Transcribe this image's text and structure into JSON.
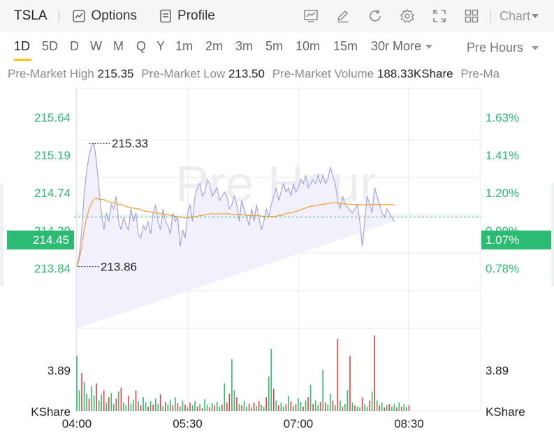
{
  "header": {
    "ticker": "TSLA",
    "options_label": "Options",
    "profile_label": "Profile",
    "chart_selector": "Chart"
  },
  "icons": [
    "options-chart-icon",
    "profile-document-icon",
    "indicator-icon",
    "draw-pen-icon",
    "refresh-icon",
    "settings-gear-icon",
    "fullscreen-icon",
    "layout-grid-icon"
  ],
  "periods": [
    "1D",
    "5D",
    "D",
    "W",
    "M",
    "Q",
    "Y",
    "1m",
    "2m",
    "3m",
    "5m",
    "10m",
    "15m",
    "30r",
    "More"
  ],
  "active_period": "1D",
  "session_selector": "Pre Hours",
  "stats": {
    "high_label": "Pre-Market High",
    "high_value": "215.35",
    "low_label": "Pre-Market Low",
    "low_value": "213.50",
    "volume_label": "Pre-Market Volume",
    "volume_value": "188.33KShare",
    "cut_label": "Pre-Ma"
  },
  "colors": {
    "up": "#2bbb72",
    "down": "#ef3b3b",
    "price_line": "#a7a2e3",
    "avg_line": "#f0a445",
    "grid": "#e6e8ec",
    "accent": "#f2c80f"
  },
  "chart_data": {
    "type": "line",
    "watermark": "Pre Hour",
    "x_ticks": [
      "04:00",
      "05:30",
      "07:00",
      "08:30"
    ],
    "x_range_minutes": [
      0,
      270
    ],
    "y_ticks": [
      "215.64",
      "215.19",
      "214.74",
      "214.29",
      "213.84"
    ],
    "y_range": [
      213.72,
      216.04
    ],
    "pct_ticks": [
      "1.63%",
      "1.41%",
      "1.20%",
      "0.99%",
      "0.78%"
    ],
    "current_price": "214.45",
    "current_pct": "1.07%",
    "annot_high": "215.33",
    "annot_low": "213.86",
    "volume_tick": "3.89",
    "volume_unit": "KShare",
    "price_series": {
      "x": [
        0,
        2,
        4,
        6,
        8,
        10,
        12,
        14,
        16,
        18,
        20,
        22,
        24,
        26,
        28,
        30,
        32,
        34,
        36,
        38,
        40,
        42,
        44,
        46,
        48,
        50,
        52,
        54,
        56,
        58,
        60,
        62,
        64,
        66,
        68,
        70,
        72,
        74,
        76,
        78,
        80,
        82,
        84,
        86,
        88,
        90,
        92,
        94,
        96,
        98,
        100,
        102,
        104,
        106,
        108,
        110,
        112,
        114,
        116,
        118,
        120,
        122,
        124,
        126,
        128,
        130,
        132,
        134,
        136,
        138,
        140,
        142,
        144,
        146,
        148,
        150,
        152,
        154,
        156,
        158,
        160,
        162,
        164,
        166,
        168,
        170,
        172,
        174,
        176,
        178,
        180,
        182,
        184,
        186,
        188,
        190,
        192,
        194,
        196,
        198,
        200,
        202,
        204,
        206,
        208,
        210,
        212,
        214,
        216,
        218,
        224,
        228,
        230,
        232,
        234,
        236,
        238,
        240,
        242,
        244,
        246,
        248,
        250,
        252,
        254,
        256,
        258,
        260,
        262,
        264,
        266,
        268,
        270
      ],
      "y": [
        213.86,
        214.0,
        214.3,
        214.74,
        215.0,
        215.19,
        215.3,
        215.33,
        215.1,
        214.8,
        214.5,
        214.3,
        214.5,
        214.4,
        214.6,
        214.55,
        214.7,
        214.4,
        214.3,
        214.45,
        214.35,
        214.3,
        214.55,
        214.4,
        214.5,
        214.25,
        214.2,
        214.35,
        214.3,
        214.4,
        214.25,
        214.5,
        214.6,
        214.4,
        214.3,
        214.55,
        214.4,
        214.35,
        214.25,
        214.5,
        214.4,
        214.45,
        214.1,
        214.3,
        214.2,
        214.5,
        214.6,
        214.4,
        214.7,
        214.8,
        214.85,
        214.7,
        214.75,
        214.9,
        214.85,
        214.7,
        214.75,
        214.8,
        214.65,
        214.7,
        214.75,
        214.7,
        214.55,
        214.6,
        214.7,
        214.6,
        214.4,
        214.65,
        214.55,
        214.45,
        214.35,
        214.55,
        214.4,
        214.6,
        214.45,
        214.3,
        214.4,
        214.55,
        214.45,
        214.6,
        214.7,
        214.8,
        214.65,
        214.75,
        214.85,
        214.75,
        214.8,
        214.7,
        214.85,
        214.75,
        214.8,
        214.9,
        214.85,
        214.95,
        214.8,
        214.85,
        214.9,
        214.85,
        214.95,
        214.85,
        214.95,
        214.85,
        214.9,
        215.05,
        214.95,
        214.85,
        214.65,
        214.55,
        214.7,
        214.6,
        214.5,
        214.6,
        214.4,
        214.1,
        214.4,
        214.7,
        214.6,
        214.5,
        214.8,
        214.7,
        214.6,
        214.5,
        214.45,
        214.55,
        214.5,
        214.45,
        214.4
      ],
      "avg": [
        213.86,
        213.95,
        214.1,
        214.3,
        214.45,
        214.55,
        214.62,
        214.66,
        214.68,
        214.66,
        214.66,
        214.66,
        214.64,
        214.64,
        214.62,
        214.62,
        214.62,
        214.6,
        214.6,
        214.59,
        214.58,
        214.57,
        214.56,
        214.56,
        214.55,
        214.55,
        214.54,
        214.53,
        214.52,
        214.52,
        214.51,
        214.51,
        214.5,
        214.5,
        214.49,
        214.49,
        214.48,
        214.48,
        214.47,
        214.47,
        214.46,
        214.46,
        214.45,
        214.45,
        214.44,
        214.44,
        214.45,
        214.45,
        214.46,
        214.46,
        214.47,
        214.47,
        214.48,
        214.48,
        214.49,
        214.49,
        214.49,
        214.49,
        214.49,
        214.49,
        214.49,
        214.49,
        214.49,
        214.48,
        214.48,
        214.48,
        214.48,
        214.48,
        214.48,
        214.47,
        214.47,
        214.47,
        214.47,
        214.47,
        214.47,
        214.46,
        214.46,
        214.46,
        214.46,
        214.46,
        214.46,
        214.46,
        214.47,
        214.47,
        214.48,
        214.49,
        214.5,
        214.5,
        214.51,
        214.52,
        214.53,
        214.54,
        214.55,
        214.56,
        214.57,
        214.58,
        214.58,
        214.59,
        214.59,
        214.6,
        214.6,
        214.61,
        214.61,
        214.62,
        214.62,
        214.62,
        214.62,
        214.61,
        214.61,
        214.61,
        214.6,
        214.6,
        214.6,
        214.59,
        214.6,
        214.6,
        214.6,
        214.6,
        214.6,
        214.6,
        214.6,
        214.6,
        214.6,
        214.6,
        214.6,
        214.6,
        214.6
      ]
    },
    "volume_bars": {
      "x": [
        0,
        2,
        4,
        6,
        8,
        10,
        12,
        14,
        16,
        18,
        20,
        22,
        24,
        26,
        28,
        30,
        32,
        34,
        36,
        38,
        40,
        42,
        44,
        46,
        48,
        50,
        52,
        54,
        56,
        58,
        60,
        62,
        64,
        66,
        68,
        70,
        72,
        74,
        76,
        78,
        80,
        82,
        84,
        86,
        88,
        90,
        92,
        94,
        96,
        98,
        100,
        102,
        104,
        106,
        108,
        110,
        112,
        114,
        116,
        118,
        120,
        122,
        124,
        126,
        128,
        130,
        132,
        134,
        136,
        138,
        140,
        142,
        144,
        146,
        148,
        150,
        152,
        154,
        156,
        158,
        160,
        162,
        164,
        166,
        168,
        170,
        172,
        174,
        176,
        178,
        180,
        182,
        184,
        186,
        188,
        190,
        192,
        194,
        196,
        198,
        200,
        202,
        204,
        206,
        208,
        210,
        212,
        214,
        216,
        218,
        220,
        222,
        224,
        226,
        228,
        230,
        232,
        234,
        236,
        238,
        240,
        242,
        244,
        246,
        248,
        250,
        252,
        254,
        256,
        258,
        260,
        262,
        264,
        266,
        268,
        270
      ],
      "values": [
        8.0,
        3.0,
        5.5,
        4.2,
        2.5,
        1.8,
        3.6,
        2.2,
        4.0,
        1.5,
        2.4,
        3.0,
        1.2,
        2.0,
        2.6,
        1.0,
        1.8,
        2.8,
        3.4,
        1.2,
        0.8,
        2.2,
        1.0,
        1.6,
        3.0,
        1.4,
        0.8,
        2.0,
        1.2,
        0.6,
        1.4,
        0.9,
        1.8,
        1.0,
        2.4,
        0.7,
        1.3,
        0.9,
        1.6,
        0.8,
        2.0,
        1.1,
        0.6,
        1.5,
        0.9,
        0.5,
        1.2,
        0.8,
        1.4,
        0.6,
        1.0,
        0.4,
        1.7,
        0.9,
        0.5,
        1.1,
        0.8,
        1.3,
        0.6,
        0.9,
        4.0,
        1.2,
        2.5,
        7.5,
        3.0,
        2.0,
        1.0,
        0.8,
        1.5,
        0.6,
        1.0,
        0.5,
        1.2,
        0.7,
        1.4,
        0.9,
        0.6,
        2.0,
        5.0,
        9.0,
        3.2,
        1.5,
        0.8,
        1.2,
        0.6,
        1.0,
        2.2,
        1.4,
        0.7,
        1.0,
        1.8,
        1.3,
        0.6,
        1.5,
        2.0,
        3.8,
        1.0,
        1.5,
        0.8,
        1.3,
        6.0,
        1.2,
        0.9,
        2.5,
        1.5,
        0.8,
        10.5,
        1.5,
        0.6,
        1.0,
        3.0,
        8.0,
        1.2,
        0.8,
        0.6,
        0.5,
        2.0,
        1.0,
        0.6,
        1.5,
        2.8,
        11.0,
        1.5,
        0.8,
        1.2,
        0.5,
        0.8,
        1.0,
        0.6,
        1.0,
        0.5,
        1.2,
        0.6,
        1.0,
        0.5,
        0.8
      ],
      "up": [
        1,
        1,
        0,
        1,
        1,
        0,
        1,
        1,
        0,
        1,
        1,
        0,
        1,
        0,
        1,
        1,
        0,
        1,
        0,
        1,
        1,
        0,
        1,
        1,
        0,
        1,
        0,
        1,
        1,
        0,
        1,
        0,
        1,
        1,
        0,
        1,
        0,
        1,
        1,
        0,
        1,
        0,
        1,
        1,
        0,
        1,
        0,
        1,
        1,
        0,
        1,
        0,
        1,
        1,
        0,
        1,
        0,
        1,
        1,
        0,
        1,
        0,
        0,
        1,
        1,
        0,
        1,
        0,
        1,
        1,
        0,
        1,
        0,
        1,
        0,
        1,
        1,
        0,
        1,
        1,
        0,
        1,
        0,
        1,
        1,
        0,
        1,
        0,
        1,
        0,
        1,
        1,
        0,
        1,
        0,
        1,
        0,
        1,
        1,
        0,
        1,
        0,
        1,
        1,
        0,
        1,
        0,
        1,
        0,
        1,
        1,
        0,
        1,
        0,
        1,
        1,
        0,
        1,
        1,
        0,
        1,
        0,
        1,
        0,
        1,
        0,
        1,
        0,
        1,
        1,
        0,
        1,
        0,
        1,
        1,
        0
      ]
    }
  }
}
